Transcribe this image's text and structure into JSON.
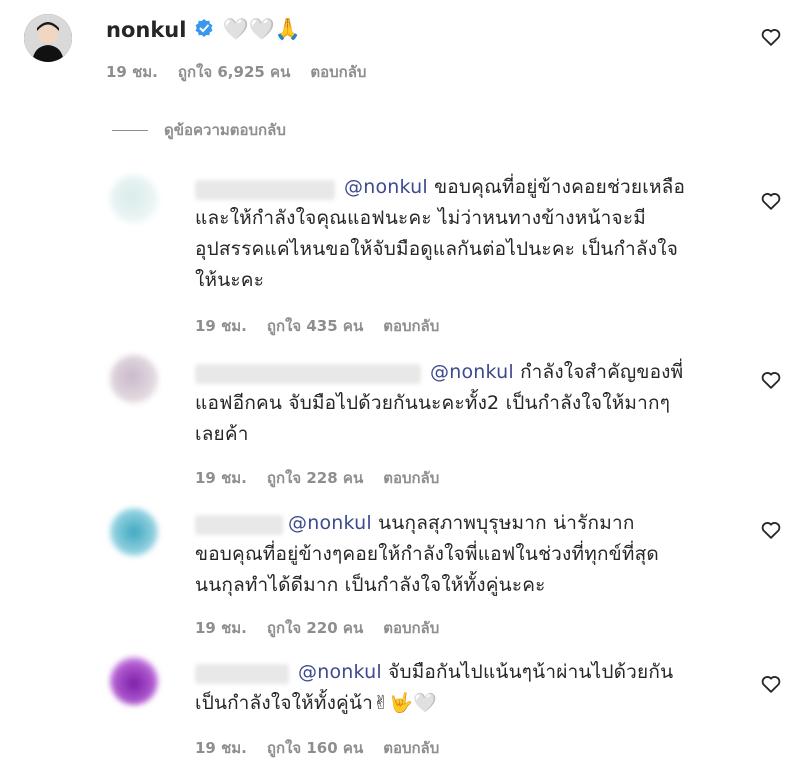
{
  "owner_comment": {
    "username": "nonkul",
    "verified_icon": "verified-badge-icon",
    "emoji_text": "🤍🤍🙏",
    "time": "19 ชม.",
    "likes": "ถูกใจ 6,925 คน",
    "reply_label": "ตอบกลับ"
  },
  "view_replies_label": "ดูข้อความตอบกลับ",
  "replies": [
    {
      "mention": "@nonkul",
      "text_lines": [
        "ขอบคุณที่อยู่ข้างคอยช่วยเหลือ",
        "และให้กำลังใจคุณแอฟนะคะ ไม่ว่าหนทางข้างหน้าจะมี",
        "อุปสรรคแค่ไหนขอให้จับมือดูแลกันต่อไปนะคะ เป็นกำลังใจ",
        "ให้นะคะ"
      ],
      "time": "19 ชม.",
      "likes": "ถูกใจ 435 คน",
      "reply_label": "ตอบกลับ"
    },
    {
      "mention": "@nonkul",
      "text_lines": [
        "กำลังใจสำคัญของพี่",
        "แอฟอีกคน จับมือไปด้วยกันนะคะทั้ง2 เป็นกำลังใจให้มากๆ",
        "เลยค้า"
      ],
      "time": "19 ชม.",
      "likes": "ถูกใจ 228 คน",
      "reply_label": "ตอบกลับ"
    },
    {
      "mention": "@nonkul",
      "text_lines": [
        "นนกุลสุภาพบุรุษมาก น่ารักมาก",
        "ขอบคุณที่อยู่ข้างๆคอยให้กำลังใจพี่แอฟในช่วงที่ทุกข์ที่สุด",
        "นนกุลทำได้ดีมาก เป็นกำลังใจให้ทั้งคู่นะคะ"
      ],
      "time": "19 ชม.",
      "likes": "ถูกใจ 220 คน",
      "reply_label": "ตอบกลับ"
    },
    {
      "mention": "@nonkul",
      "text_lines": [
        "จับมือกันไปแน้นๆน้าผ่านไปด้วยกัน",
        "เป็นกำลังใจให้ทั้งคู่น้า✌🤟🤍"
      ],
      "time": "19 ชม.",
      "likes": "ถูกใจ 160 คน",
      "reply_label": "ตอบกลับ"
    }
  ],
  "like_icon": "heart-outline-icon",
  "colors": {
    "mention": "#3d4b8e",
    "meta": "#8e8e8e",
    "text": "#262626"
  }
}
